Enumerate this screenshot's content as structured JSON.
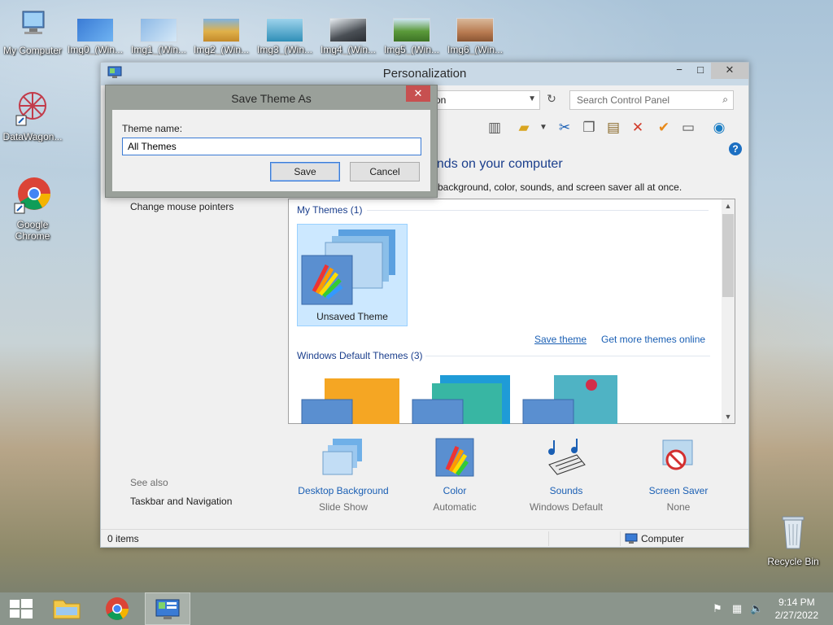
{
  "desktop": {
    "icons": [
      {
        "label": "My Computer"
      },
      {
        "label": "Img0_(Win..."
      },
      {
        "label": "Img1_(Win..."
      },
      {
        "label": "Img2_(Win..."
      },
      {
        "label": "Img3_(Win..."
      },
      {
        "label": "Img4_(Win..."
      },
      {
        "label": "Img5_(Win..."
      },
      {
        "label": "Img6_(Win..."
      },
      {
        "label": "DataWagon..."
      },
      {
        "label": "Google Chrome"
      },
      {
        "label": "Recycle Bin"
      }
    ]
  },
  "window": {
    "title": "Personalization",
    "address": "on",
    "search_placeholder": "Search Control Panel",
    "heading": "unds on your computer",
    "subheading": "p background, color, sounds, and screen saver all at once.",
    "side_links": [
      "Change mouse pointers"
    ],
    "see_also_label": "See also",
    "see_also_links": [
      "Taskbar and Navigation"
    ],
    "themes": {
      "my_themes_title": "My Themes (1)",
      "unsaved_theme": "Unsaved Theme",
      "save_theme": "Save theme",
      "get_more": "Get more themes online",
      "default_themes_title": "Windows Default Themes (3)"
    },
    "settings": [
      {
        "title": "Desktop Background",
        "value": "Slide Show"
      },
      {
        "title": "Color",
        "value": "Automatic"
      },
      {
        "title": "Sounds",
        "value": "Windows Default"
      },
      {
        "title": "Screen Saver",
        "value": "None"
      }
    ],
    "status": {
      "items": "0 items",
      "location": "Computer"
    }
  },
  "dialog": {
    "title": "Save Theme As",
    "label": "Theme name:",
    "value": "All Themes",
    "save": "Save",
    "cancel": "Cancel"
  },
  "taskbar": {
    "time": "9:14 PM",
    "date": "2/27/2022"
  }
}
